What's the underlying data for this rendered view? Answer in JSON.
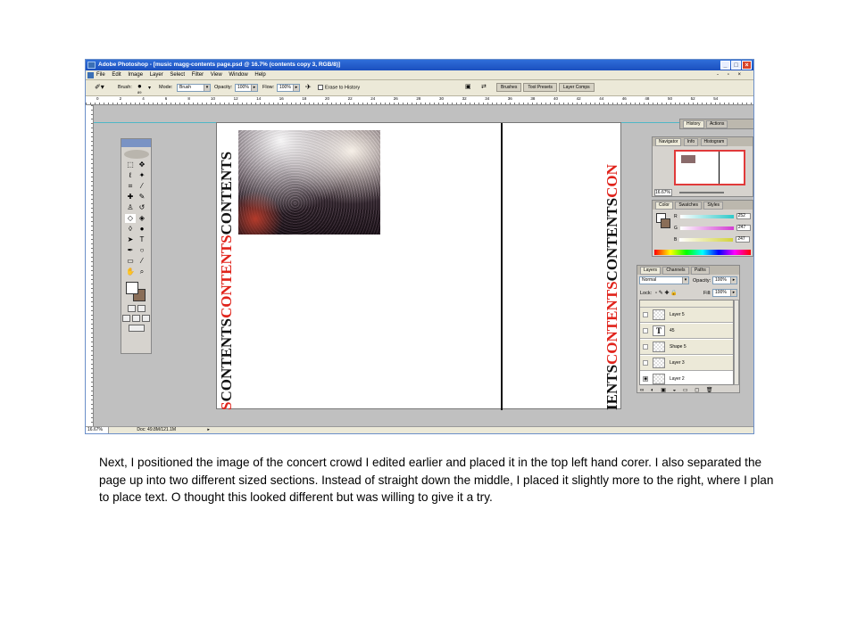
{
  "window": {
    "title": "Adobe Photoshop - [music magg-contents page.psd @ 16.7% (contents copy 3, RGB/8)]",
    "controls": [
      "_",
      "□",
      "×"
    ]
  },
  "menubar": [
    "File",
    "Edit",
    "Image",
    "Layer",
    "Select",
    "Filter",
    "View",
    "Window",
    "Help"
  ],
  "options_bar": {
    "brush_label": "Brush:",
    "brush_size": "89",
    "mode_label": "Mode:",
    "mode_value": "Brush",
    "opacity_label": "Opacity:",
    "opacity_value": "100%",
    "flow_label": "Flow:",
    "flow_value": "100%",
    "erase_history": "Erase to History",
    "wells": [
      "Brushes",
      "Tool Presets",
      "Layer Comps"
    ]
  },
  "ruler_ticks": [
    "0",
    "2",
    "4",
    "6",
    "8",
    "10",
    "12",
    "14",
    "16",
    "18",
    "20",
    "22",
    "24",
    "26",
    "28",
    "30",
    "32",
    "34",
    "36",
    "38",
    "40",
    "42",
    "44",
    "46",
    "48",
    "50",
    "52",
    "54"
  ],
  "canvas": {
    "vertical_text_left": [
      {
        "t": "S",
        "c": "red"
      },
      {
        "t": "CONTENTS",
        "c": "blk"
      },
      {
        "t": "CONTENTS",
        "c": "red"
      },
      {
        "t": "CONTENTS",
        "c": "blk"
      }
    ],
    "vertical_text_right": [
      {
        "t": "IENTS",
        "c": "blk"
      },
      {
        "t": "CONTENTS",
        "c": "red"
      },
      {
        "t": "CONTENTS",
        "c": "blk"
      },
      {
        "t": "CON",
        "c": "red"
      }
    ]
  },
  "history_panel": {
    "tabs": [
      "History",
      "Actions"
    ]
  },
  "navigator_panel": {
    "tabs": [
      "Navigator",
      "Info",
      "Histogram"
    ],
    "zoom": "16.67%"
  },
  "color_panel": {
    "tabs": [
      "Color",
      "Swatches",
      "Styles"
    ],
    "channels": [
      {
        "label": "R",
        "value": "252",
        "color": "#2ec9c9"
      },
      {
        "label": "G",
        "value": "247",
        "color": "#d23bd2"
      },
      {
        "label": "B",
        "value": "247",
        "color": "#d2d23b"
      }
    ]
  },
  "layers_panel": {
    "tabs": [
      "Layers",
      "Channels",
      "Paths"
    ],
    "blend_mode": "Normal",
    "opacity_label": "Opacity:",
    "opacity_value": "100%",
    "lock_label": "Lock:",
    "fill_label": "Fill:",
    "fill_value": "100%",
    "layers": [
      {
        "name": "Layer 5",
        "type": "raster",
        "visible": false
      },
      {
        "name": "45",
        "type": "text",
        "visible": false
      },
      {
        "name": "Shape 5",
        "type": "raster",
        "visible": false
      },
      {
        "name": "Layer 3",
        "type": "raster",
        "visible": false
      },
      {
        "name": "Layer 2",
        "type": "raster",
        "visible": true
      }
    ]
  },
  "status_bar": {
    "zoom": "16.67%",
    "doc": "Doc: 49.8M/121.1M"
  },
  "caption": "Next, I positioned the image of the concert crowd I edited earlier and placed it in the top left hand corer. I also separated the page up into two different sized sections. Instead of straight down the middle, I placed it slightly more to the right, where I plan to place text. O thought this looked different but was willing to give it a try."
}
